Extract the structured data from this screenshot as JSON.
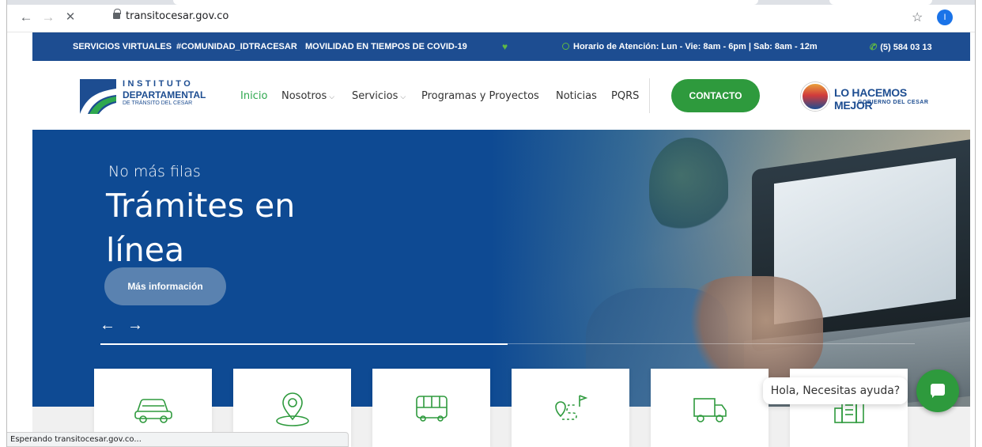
{
  "browser": {
    "url": "transitocesar.gov.co",
    "back_icon": "←",
    "forward_icon": "→",
    "stop_icon": "✕",
    "star_icon": "☆",
    "profile_initial": "I"
  },
  "topbar": {
    "links": [
      "SERVICIOS VIRTUALES",
      "#COMUNIDAD_IDTRACESAR",
      "MOVILIDAD EN TIEMPOS DE COVID-19"
    ],
    "twitter_icon": "🐦",
    "hours": "Horario de Atención: Lun - Vie: 8am - 6pm | Sab: 8am - 12m",
    "phone": "(5) 584 03 13",
    "bg_color": "#1d4d91"
  },
  "logo": {
    "line1": "INSTITUTO",
    "line2": "DEPARTAMENTAL",
    "line3": "DE TRÁNSITO DEL CESAR"
  },
  "menu": {
    "items": [
      {
        "label": "Inicio"
      },
      {
        "label": "Nosotros",
        "chevron": "⌵"
      },
      {
        "label": "Servicios",
        "chevron": "⌵"
      },
      {
        "label": "Programas y Proyectos"
      },
      {
        "label": "Noticias"
      },
      {
        "label": "PQRS"
      }
    ],
    "contact_label": "CONTACTO",
    "active_color": "#2fa84f"
  },
  "gov": {
    "title": "LO HACEMOS MEJOR",
    "subtitle": "GOBIERNO DEL CESAR"
  },
  "hero": {
    "pretitle": "No más filas",
    "title": "Trámites en línea",
    "button": "Más información",
    "prev_icon": "←",
    "next_icon": "→",
    "slide_progress": 0.5
  },
  "cards": [
    {
      "icon": "car-icon"
    },
    {
      "icon": "location-pin-icon"
    },
    {
      "icon": "bus-icon"
    },
    {
      "icon": "route-icon"
    },
    {
      "icon": "truck-icon"
    },
    {
      "icon": "building-icon"
    }
  ],
  "chat": {
    "bubble": "Hola, Necesitas ayuda?",
    "accent": "#2e9a3d"
  },
  "status": "Esperando transitocesar.gov.co..."
}
